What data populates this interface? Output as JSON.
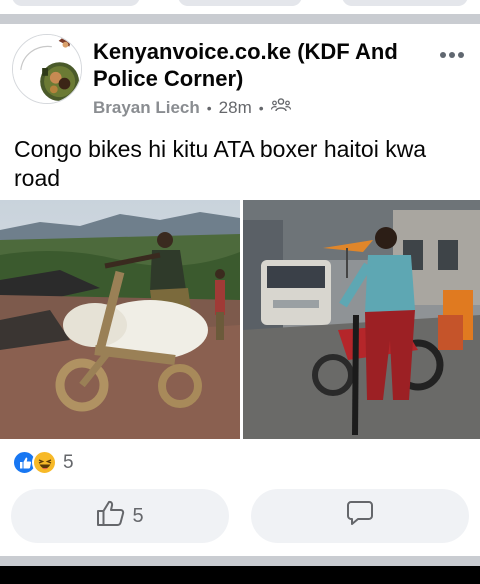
{
  "post": {
    "author": "Kenyanvoice.co.ke (KDF And Police Corner)",
    "subauthor": "Brayan Liech",
    "time": "28m",
    "text": "Congo bikes hi kitu ATA boxer haitoi kwa road"
  },
  "reactions": {
    "count": "5",
    "types": [
      "like-icon",
      "haha-icon"
    ]
  },
  "actions": {
    "like_count": "5"
  },
  "colors": {
    "like_blue": "#1877f2",
    "haha_yellow": "#f7b928",
    "separator": "#c9ccd1",
    "button_bg": "#f0f2f5",
    "secondary_text": "#65676b"
  }
}
